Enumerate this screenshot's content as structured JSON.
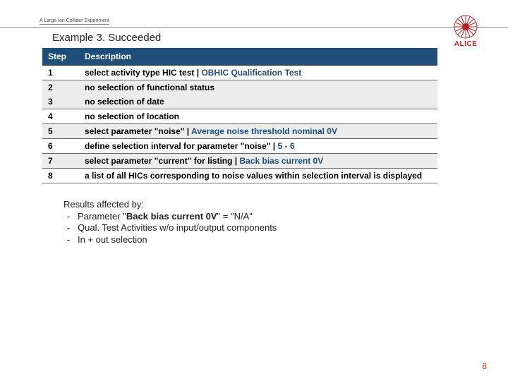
{
  "header": {
    "subtitle": "A Large Ion Collider Experiment",
    "logo_text": "ALICE"
  },
  "title": "Example 3. Succeeded",
  "table": {
    "headers": {
      "step": "Step",
      "description": "Description"
    },
    "rows": [
      {
        "step": "1",
        "pre": "select activity type HIC test",
        "sep": " | ",
        "after": "OBHIC Qualification Test"
      },
      {
        "step": "2",
        "pre": "no selection of functional status",
        "sep": "",
        "after": ""
      },
      {
        "step": "3",
        "pre": "no selection of date",
        "sep": "",
        "after": ""
      },
      {
        "step": "4",
        "pre": "no selection of location",
        "sep": "",
        "after": ""
      },
      {
        "step": "5",
        "pre": "select parameter \"noise\"",
        "sep": " | ",
        "after": "Average noise threshold nominal 0V"
      },
      {
        "step": "6",
        "pre": "define selection interval for parameter \"noise\"",
        "sep": " | ",
        "after": "5 - 6"
      },
      {
        "step": "7",
        "pre": "select parameter \"current\" for listing",
        "sep": " | ",
        "after": "Back bias current 0V"
      },
      {
        "step": "8",
        "pre": "a list of all HICs corresponding to noise values within selection interval is displayed",
        "sep": "",
        "after": ""
      }
    ]
  },
  "results": {
    "heading": "Results affected by:",
    "items": {
      "i0": {
        "pre": "Parameter \"",
        "bold": "Back bias current 0V",
        "post": "\" = \"N/A\""
      },
      "i1": {
        "text": "Qual. Test Activities w/o input/output components"
      },
      "i2": {
        "text": "In + out selection"
      }
    }
  },
  "page_number": "8"
}
